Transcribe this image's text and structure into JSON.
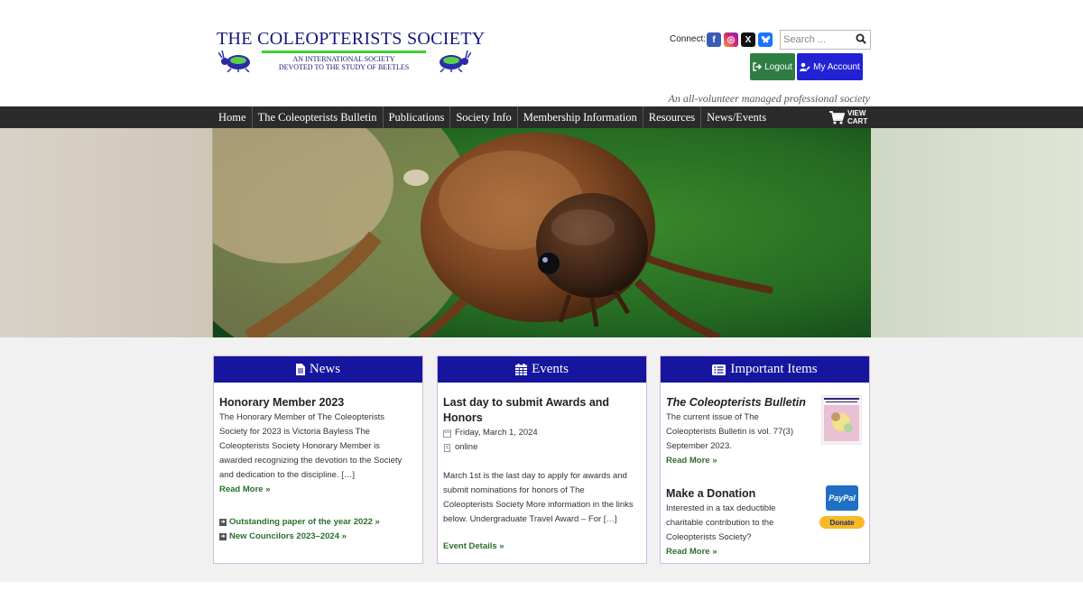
{
  "logo": {
    "title": "THE COLEOPTERISTS SOCIETY",
    "sub1": "AN INTERNATIONAL SOCIETY",
    "sub2": "DEVOTED TO THE STUDY OF BEETLES",
    "colors": {
      "text": "#15157a",
      "line": "#3fcf34"
    }
  },
  "connect_label": "Connect:",
  "social": [
    {
      "name": "facebook",
      "icon": "f"
    },
    {
      "name": "instagram",
      "icon": "◎"
    },
    {
      "name": "x",
      "icon": "X"
    },
    {
      "name": "bluesky",
      "icon": ""
    }
  ],
  "search": {
    "placeholder": "Search ...",
    "value": ""
  },
  "buttons": {
    "logout": "Logout",
    "account": "My Account"
  },
  "tagline": "An all-volunteer managed professional society",
  "nav": [
    "Home",
    "The Coleopterists Bulletin",
    "Publications",
    "Society Info",
    "Membership Information",
    "Resources",
    "News/Events"
  ],
  "cart": {
    "line1": "VIEW",
    "line2": "CART"
  },
  "news": {
    "heading": "News",
    "title": "Honorary Member 2023",
    "lines": [
      "The Honorary Member of The Coleopterists",
      "Society for 2023 is Victoria Bayless The",
      "Coleopterists Society Honorary Member is",
      "awarded recognizing the devotion to the Society",
      "and dedication to the discipline. […]"
    ],
    "read_more": "Read More »",
    "links": [
      "Outstanding paper of the year 2022 »",
      "New Councilors 2023–2024 »"
    ]
  },
  "events": {
    "heading": "Events",
    "title_lines": [
      "Last day to submit Awards and",
      "Honors"
    ],
    "date": "Friday, March 1, 2024",
    "location": "online",
    "lines": [
      "March 1st is the last day to apply for awards and",
      "submit nominations for honors of The",
      "Coleopterists Society More information in the links",
      "below. Undergraduate Travel Award – For […]"
    ],
    "details": "Event Details »"
  },
  "important": {
    "heading": "Important Items",
    "bulletin_title": "The Coleopterists Bulletin",
    "bulletin_lines": [
      "The current issue of The",
      "Coleopterists Bulletin is vol. 77(3)",
      "September 2023."
    ],
    "read_more1": "Read More »",
    "donation_title": "Make a Donation",
    "donation_lines": [
      "Interested in a tax deductible",
      "charitable contribution to the",
      "Coleopterists Society?"
    ],
    "read_more2": "Read More »",
    "paypal_label": "PayPal",
    "donate_label": "Donate"
  },
  "colors": {
    "nav": "#2b2b2b",
    "card_header": "#15159e",
    "link": "#2a6e2e",
    "logout": "#2e7d43",
    "account": "#2222d4"
  }
}
